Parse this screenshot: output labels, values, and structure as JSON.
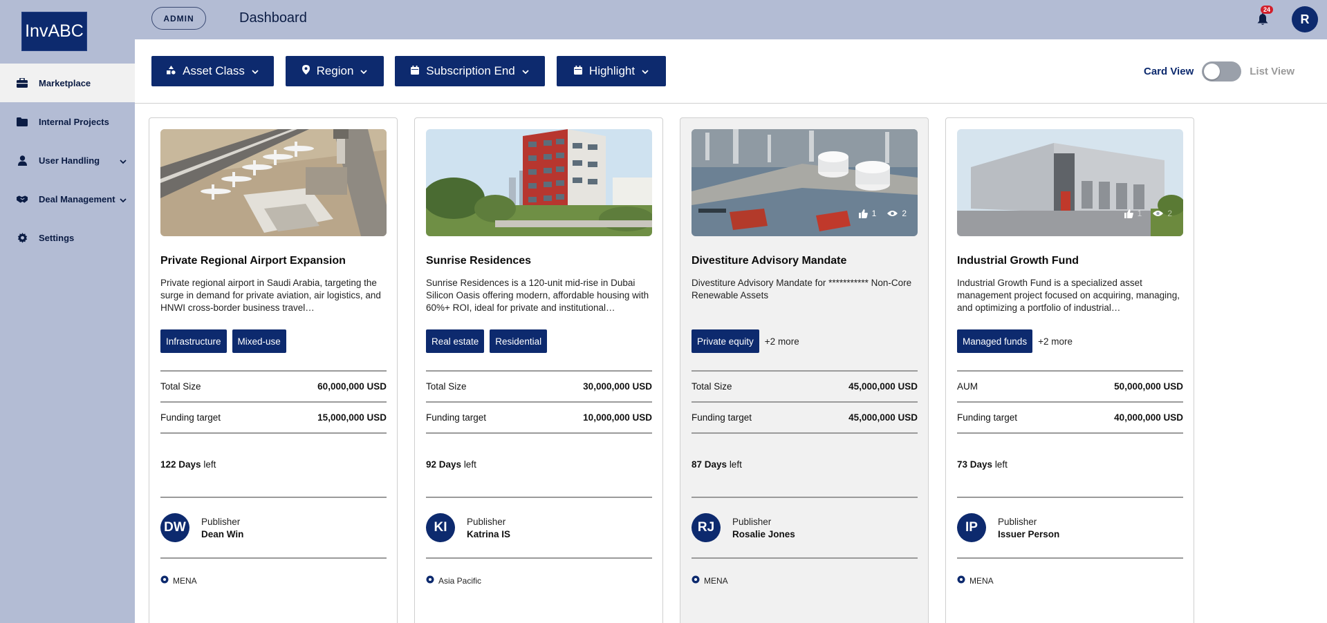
{
  "app": {
    "logo": "InvABC",
    "role_badge": "ADMIN",
    "page_title": "Dashboard",
    "notification_count": "24",
    "user_initial": "R"
  },
  "sidebar": {
    "items": [
      {
        "label": "Marketplace",
        "icon": "briefcase-icon",
        "active": true
      },
      {
        "label": "Internal Projects",
        "icon": "folder-icon"
      },
      {
        "label": "User Handling",
        "icon": "user-icon",
        "expandable": true
      },
      {
        "label": "Deal Management",
        "icon": "handshake-icon",
        "expandable": true
      },
      {
        "label": "Settings",
        "icon": "gear-icon"
      }
    ]
  },
  "filters": [
    {
      "label": "Asset Class",
      "icon": "shapes-icon"
    },
    {
      "label": "Region",
      "icon": "location-pin-icon"
    },
    {
      "label": "Subscription End",
      "icon": "calendar-icon"
    },
    {
      "label": "Highlight",
      "icon": "calendar-icon"
    }
  ],
  "view_toggle": {
    "card_label": "Card View",
    "list_label": "List View",
    "selected": "Card View"
  },
  "cards": [
    {
      "title": "Private Regional Airport Expansion",
      "description": "Private regional airport in Saudi Arabia, targeting the surge in demand for private aviation, air logistics, and HNWI cross-border business travel…",
      "tags": [
        "Infrastructure",
        "Mixed-use"
      ],
      "more": "",
      "metric1_label": "Total Size",
      "metric1_value": "60,000,000 USD",
      "metric2_label": "Funding target",
      "metric2_value": "15,000,000 USD",
      "days_value": "122 Days",
      "days_suffix": "left",
      "publisher_label": "Publisher",
      "publisher_initials": "DW",
      "publisher_name": "Dean Win",
      "region": "MENA",
      "likes": "",
      "views": ""
    },
    {
      "title": "Sunrise Residences",
      "description": "Sunrise Residences is a 120-unit mid-rise in Dubai Silicon Oasis offering modern, affordable housing with 60%+ ROI, ideal for private and institutional…",
      "tags": [
        "Real estate",
        "Residential"
      ],
      "more": "",
      "metric1_label": "Total Size",
      "metric1_value": "30,000,000 USD",
      "metric2_label": "Funding target",
      "metric2_value": "10,000,000 USD",
      "days_value": "92 Days",
      "days_suffix": "left",
      "publisher_label": "Publisher",
      "publisher_initials": "KI",
      "publisher_name": "Katrina IS",
      "region": "Asia Pacific",
      "likes": "",
      "views": ""
    },
    {
      "title": "Divestiture Advisory Mandate",
      "description": "Divestiture Advisory Mandate for *********** Non-Core Renewable Assets",
      "tags": [
        "Private equity"
      ],
      "more": "+2 more",
      "metric1_label": "Total Size",
      "metric1_value": "45,000,000 USD",
      "metric2_label": "Funding target",
      "metric2_value": "45,000,000 USD",
      "days_value": "87 Days",
      "days_suffix": "left",
      "publisher_label": "Publisher",
      "publisher_initials": "RJ",
      "publisher_name": "Rosalie Jones",
      "region": "MENA",
      "likes": "1",
      "views": "2"
    },
    {
      "title": "Industrial Growth Fund",
      "description": "Industrial Growth Fund is a specialized asset management project focused on acquiring, managing, and optimizing a portfolio of industrial…",
      "tags": [
        "Managed funds"
      ],
      "more": "+2 more",
      "metric1_label": "AUM",
      "metric1_value": "50,000,000 USD",
      "metric2_label": "Funding target",
      "metric2_value": "40,000,000 USD",
      "days_value": "73 Days",
      "days_suffix": "left",
      "publisher_label": "Publisher",
      "publisher_initials": "IP",
      "publisher_name": "Issuer Person",
      "region": "MENA",
      "likes": "1",
      "views": "2"
    }
  ],
  "colors": {
    "primary": "#0d2a6e",
    "sidebar_bg": "#b3bcd4",
    "badge_red": "#d21f2b"
  }
}
